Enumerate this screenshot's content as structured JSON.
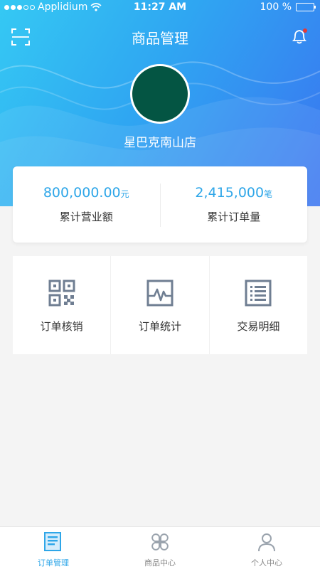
{
  "status_bar": {
    "carrier": "Applidium",
    "time": "11:27 AM",
    "battery": "100 %"
  },
  "nav": {
    "title": "商品管理",
    "scan_icon": "scan-icon",
    "bell_icon": "bell-icon"
  },
  "store": {
    "name": "星巴克南山店",
    "avatar_color": "#045543"
  },
  "stats": [
    {
      "value": "800,000.00",
      "unit": "元",
      "label": "累计营业额"
    },
    {
      "value": "2,415,000",
      "unit": "笔",
      "label": "累计订单量"
    }
  ],
  "actions": [
    {
      "label": "订单核销",
      "icon": "qr-code-icon"
    },
    {
      "label": "订单统计",
      "icon": "chart-icon"
    },
    {
      "label": "交易明细",
      "icon": "list-icon"
    }
  ],
  "tabs": [
    {
      "label": "订单管理",
      "icon": "order-icon",
      "active": true
    },
    {
      "label": "商品中心",
      "icon": "clover-icon",
      "active": false
    },
    {
      "label": "个人中心",
      "icon": "person-icon",
      "active": false
    }
  ],
  "colors": {
    "accent": "#2ea6e8",
    "gradient_start": "#35c9f3",
    "gradient_end": "#3a74f0",
    "notification_dot": "#e53935"
  }
}
